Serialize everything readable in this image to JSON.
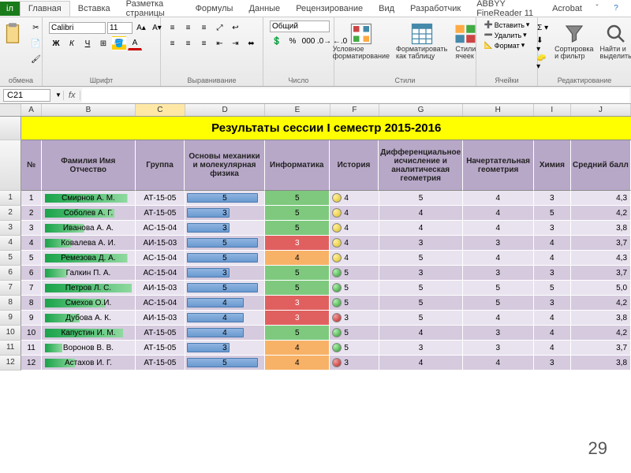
{
  "ribbon": {
    "tabs": [
      "Главная",
      "Вставка",
      "Разметка страницы",
      "Формулы",
      "Данные",
      "Рецензирование",
      "Вид",
      "Разработчик",
      "ABBYY FineReader 11",
      "Acrobat"
    ],
    "active_tab": 0,
    "clipboard_label": "обмена",
    "paste_label": "Вставить",
    "font": {
      "name": "Calibri",
      "size": "11",
      "group_label": "Шрифт"
    },
    "align": {
      "group_label": "Выравнивание"
    },
    "number": {
      "format": "Общий",
      "group_label": "Число"
    },
    "styles": {
      "cond_fmt": "Условное\nформатирование",
      "as_table": "Форматировать\nкак таблицу",
      "cell_styles": "Стили\nячеек",
      "group_label": "Стили"
    },
    "cells": {
      "insert": "Вставить",
      "delete": "Удалить",
      "format": "Формат",
      "group_label": "Ячейки"
    },
    "editing": {
      "sort": "Сортировка\nи фильтр",
      "find": "Найти и\nвыделить",
      "group_label": "Редактирование"
    }
  },
  "formula_bar": {
    "cell_ref": "C21",
    "fx": "fx",
    "value": ""
  },
  "columns": [
    "A",
    "B",
    "C",
    "D",
    "E",
    "F",
    "G",
    "H",
    "I",
    "J"
  ],
  "selected_col": "C",
  "banner": "Результаты сессии I семестр 2015-2016",
  "headers": [
    "№",
    "Фамилия Имя Отчество",
    "Группа",
    "Основы механики и молекулярная физика",
    "Информатика",
    "История",
    "Дифференциальное исчисление и аналитическая геометрия",
    "Начертательная геометрия",
    "Химия",
    "Средний балл"
  ],
  "rows": [
    {
      "n": 1,
      "fio": "Смирнов А. М.",
      "fio_pct": 95,
      "grp": "АТ-15-05",
      "mech": 5,
      "inf": 5,
      "hist": 4,
      "hist_t": "y",
      "diff": 5,
      "nach": 4,
      "chem": 3,
      "avg": "4,3"
    },
    {
      "n": 2,
      "fio": "Соболев А. Г.",
      "fio_pct": 80,
      "grp": "АТ-15-05",
      "mech": 3,
      "inf": 5,
      "hist": 4,
      "hist_t": "y",
      "diff": 4,
      "nach": 4,
      "chem": 5,
      "avg": "4,2"
    },
    {
      "n": 3,
      "fio": "Иванова А. А.",
      "fio_pct": 45,
      "grp": "АС-15-04",
      "mech": 3,
      "inf": 5,
      "hist": 4,
      "hist_t": "y",
      "diff": 4,
      "nach": 4,
      "chem": 3,
      "avg": "3,8"
    },
    {
      "n": 4,
      "fio": "Ковалева А. И.",
      "fio_pct": 30,
      "grp": "АИ-15-03",
      "mech": 5,
      "inf": 3,
      "hist": 4,
      "hist_t": "y",
      "diff": 3,
      "nach": 3,
      "chem": 4,
      "avg": "3,7"
    },
    {
      "n": 5,
      "fio": "Ремезова Д. А.",
      "fio_pct": 95,
      "grp": "АС-15-04",
      "mech": 5,
      "inf": 4,
      "hist": 4,
      "hist_t": "y",
      "diff": 5,
      "nach": 4,
      "chem": 4,
      "avg": "4,3"
    },
    {
      "n": 6,
      "fio": "Галкин П. А.",
      "fio_pct": 25,
      "grp": "АС-15-04",
      "mech": 3,
      "inf": 5,
      "hist": 5,
      "hist_t": "g",
      "diff": 3,
      "nach": 3,
      "chem": 3,
      "avg": "3,7"
    },
    {
      "n": 7,
      "fio": "Петров Л. С.",
      "fio_pct": 100,
      "grp": "АИ-15-03",
      "mech": 5,
      "inf": 5,
      "hist": 5,
      "hist_t": "g",
      "diff": 5,
      "nach": 5,
      "chem": 5,
      "avg": "5,0"
    },
    {
      "n": 8,
      "fio": "Смехов О.И.",
      "fio_pct": 70,
      "grp": "АС-15-04",
      "mech": 4,
      "inf": 3,
      "hist": 5,
      "hist_t": "g",
      "diff": 5,
      "nach": 5,
      "chem": 3,
      "avg": "4,2"
    },
    {
      "n": 9,
      "fio": "Дубова А. К.",
      "fio_pct": 40,
      "grp": "АИ-15-03",
      "mech": 4,
      "inf": 3,
      "hist": 3,
      "hist_t": "r",
      "diff": 5,
      "nach": 4,
      "chem": 4,
      "avg": "3,8"
    },
    {
      "n": 10,
      "fio": "Капустин И. М.",
      "fio_pct": 90,
      "grp": "АТ-15-05",
      "mech": 4,
      "inf": 5,
      "hist": 5,
      "hist_t": "g",
      "diff": 4,
      "nach": 3,
      "chem": 4,
      "avg": "4,2"
    },
    {
      "n": 11,
      "fio": "Воронов В. В.",
      "fio_pct": 20,
      "grp": "АТ-15-05",
      "mech": 3,
      "inf": 4,
      "hist": 5,
      "hist_t": "g",
      "diff": 3,
      "nach": 3,
      "chem": 4,
      "avg": "3,7"
    },
    {
      "n": 12,
      "fio": "Астахов И. Г.",
      "fio_pct": 35,
      "grp": "АТ-15-05",
      "mech": 5,
      "inf": 4,
      "hist": 3,
      "hist_t": "r",
      "diff": 4,
      "nach": 4,
      "chem": 3,
      "avg": "3,8"
    }
  ],
  "page_number": "29",
  "chart_data": {
    "type": "table",
    "title": "Результаты сессии I семестр 2015-2016",
    "columns": [
      "№",
      "Фамилия Имя Отчество",
      "Группа",
      "Основы механики и молекулярная физика",
      "Информатика",
      "История",
      "Дифференциальное исчисление и аналитическая геометрия",
      "Начертательная геометрия",
      "Химия",
      "Средний балл"
    ],
    "data": [
      [
        1,
        "Смирнов А. М.",
        "АТ-15-05",
        5,
        5,
        4,
        5,
        4,
        3,
        4.3
      ],
      [
        2,
        "Соболев А. Г.",
        "АТ-15-05",
        3,
        5,
        4,
        4,
        4,
        5,
        4.2
      ],
      [
        3,
        "Иванова А. А.",
        "АС-15-04",
        3,
        5,
        4,
        4,
        4,
        3,
        3.8
      ],
      [
        4,
        "Ковалева А. И.",
        "АИ-15-03",
        5,
        3,
        4,
        3,
        3,
        4,
        3.7
      ],
      [
        5,
        "Ремезова Д. А.",
        "АС-15-04",
        5,
        4,
        4,
        5,
        4,
        4,
        4.3
      ],
      [
        6,
        "Галкин П. А.",
        "АС-15-04",
        3,
        5,
        5,
        3,
        3,
        3,
        3.7
      ],
      [
        7,
        "Петров Л. С.",
        "АИ-15-03",
        5,
        5,
        5,
        5,
        5,
        5,
        5.0
      ],
      [
        8,
        "Смехов О.И.",
        "АС-15-04",
        4,
        3,
        5,
        5,
        5,
        3,
        4.2
      ],
      [
        9,
        "Дубова А. К.",
        "АИ-15-03",
        4,
        3,
        3,
        5,
        4,
        4,
        3.8
      ],
      [
        10,
        "Капустин И. М.",
        "АТ-15-05",
        4,
        5,
        5,
        4,
        3,
        4,
        4.2
      ],
      [
        11,
        "Воронов В. В.",
        "АТ-15-05",
        3,
        4,
        5,
        3,
        3,
        4,
        3.7
      ],
      [
        12,
        "Астахов И. Г.",
        "АТ-15-05",
        5,
        4,
        3,
        4,
        4,
        3,
        3.8
      ]
    ]
  }
}
